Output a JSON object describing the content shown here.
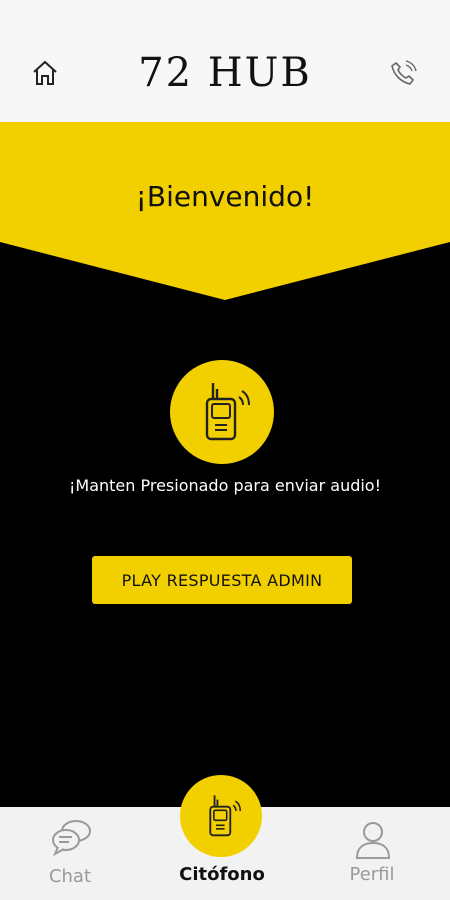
{
  "header": {
    "logo": "72 HUB",
    "home_icon": "home-icon",
    "phone_icon": "phone-icon"
  },
  "welcome": {
    "title": "¡Bienvenido!"
  },
  "main": {
    "hold_text": "¡Manten Presionado para enviar audio!",
    "play_button": "PLAY RESPUESTA ADMIN",
    "walkie_icon": "walkie-talkie-icon"
  },
  "tabs": [
    {
      "label": "Chat",
      "icon": "chat-bubbles-icon"
    },
    {
      "label": "Citófono",
      "icon": "walkie-talkie-icon"
    },
    {
      "label": "Perfil",
      "icon": "user-icon"
    }
  ],
  "colors": {
    "accent": "#F2D000",
    "background": "#000000",
    "header_bg": "#F7F7F7",
    "tabbar_bg": "#F2F2F2",
    "inactive_text": "#9A9A9A"
  }
}
